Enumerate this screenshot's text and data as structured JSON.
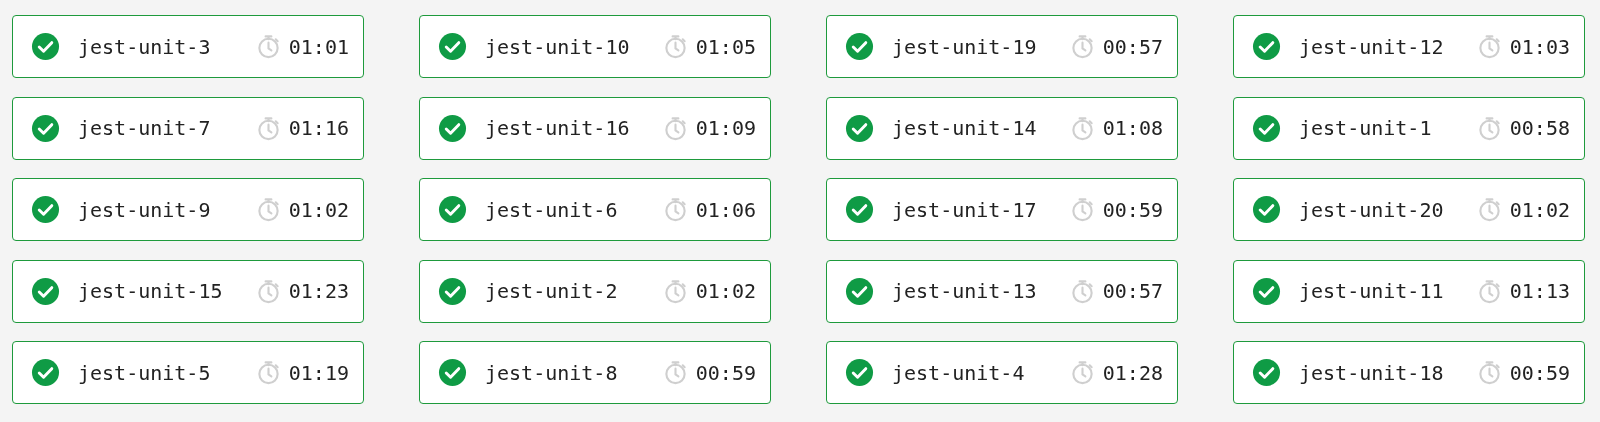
{
  "jobs": [
    {
      "name": "jest-unit-3",
      "passed": true,
      "duration": "01:01"
    },
    {
      "name": "jest-unit-10",
      "passed": true,
      "duration": "01:05"
    },
    {
      "name": "jest-unit-19",
      "passed": true,
      "duration": "00:57"
    },
    {
      "name": "jest-unit-12",
      "passed": true,
      "duration": "01:03"
    },
    {
      "name": "jest-unit-7",
      "passed": true,
      "duration": "01:16"
    },
    {
      "name": "jest-unit-16",
      "passed": true,
      "duration": "01:09"
    },
    {
      "name": "jest-unit-14",
      "passed": true,
      "duration": "01:08"
    },
    {
      "name": "jest-unit-1",
      "passed": true,
      "duration": "00:58"
    },
    {
      "name": "jest-unit-9",
      "passed": true,
      "duration": "01:02"
    },
    {
      "name": "jest-unit-6",
      "passed": true,
      "duration": "01:06"
    },
    {
      "name": "jest-unit-17",
      "passed": true,
      "duration": "00:59"
    },
    {
      "name": "jest-unit-20",
      "passed": true,
      "duration": "01:02"
    },
    {
      "name": "jest-unit-15",
      "passed": true,
      "duration": "01:23"
    },
    {
      "name": "jest-unit-2",
      "passed": true,
      "duration": "01:02"
    },
    {
      "name": "jest-unit-13",
      "passed": true,
      "duration": "00:57"
    },
    {
      "name": "jest-unit-11",
      "passed": true,
      "duration": "01:13"
    },
    {
      "name": "jest-unit-5",
      "passed": true,
      "duration": "01:19"
    },
    {
      "name": "jest-unit-8",
      "passed": true,
      "duration": "00:59"
    },
    {
      "name": "jest-unit-4",
      "passed": true,
      "duration": "01:28"
    },
    {
      "name": "jest-unit-18",
      "passed": true,
      "duration": "00:59"
    }
  ]
}
